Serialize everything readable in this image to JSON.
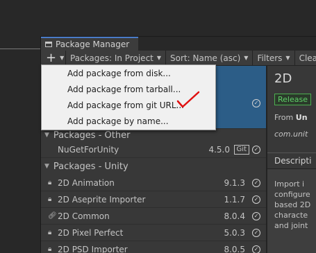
{
  "window": {
    "tab_title": "Package Manager"
  },
  "toolbar": {
    "add_label": "+",
    "packages_label": "Packages: In Project",
    "sort_label": "Sort: Name (asc)",
    "filters_label": "Filters",
    "clear_label": "Clear Fil"
  },
  "menu": {
    "items": [
      "Add package from disk...",
      "Add package from tarball...",
      "Add package from git URL...",
      "Add package by name..."
    ]
  },
  "list": {
    "group_other": "Packages - Other",
    "other_items": [
      {
        "name": "NuGetForUnity",
        "version": "4.5.0",
        "badge": "Git"
      }
    ],
    "group_unity": "Packages - Unity",
    "unity_items": [
      {
        "name": "2D Animation",
        "version": "9.1.3"
      },
      {
        "name": "2D Aseprite Importer",
        "version": "1.1.7"
      },
      {
        "name": "2D Common",
        "version": "8.0.4"
      },
      {
        "name": "2D Pixel Perfect",
        "version": "5.0.3"
      },
      {
        "name": "2D PSD Importer",
        "version": "8.0.5"
      }
    ]
  },
  "details": {
    "title": "2D",
    "badge": "Release",
    "from_prefix": "From",
    "from_value": "Un",
    "package_id": "com.unit",
    "desc_tab": "Descripti",
    "desc_text": "Import i configure based 2D characte and joint"
  },
  "colors": {
    "selection": "#2c5d87",
    "annotation_check": "#e01010",
    "release_green": "#5fd068"
  }
}
